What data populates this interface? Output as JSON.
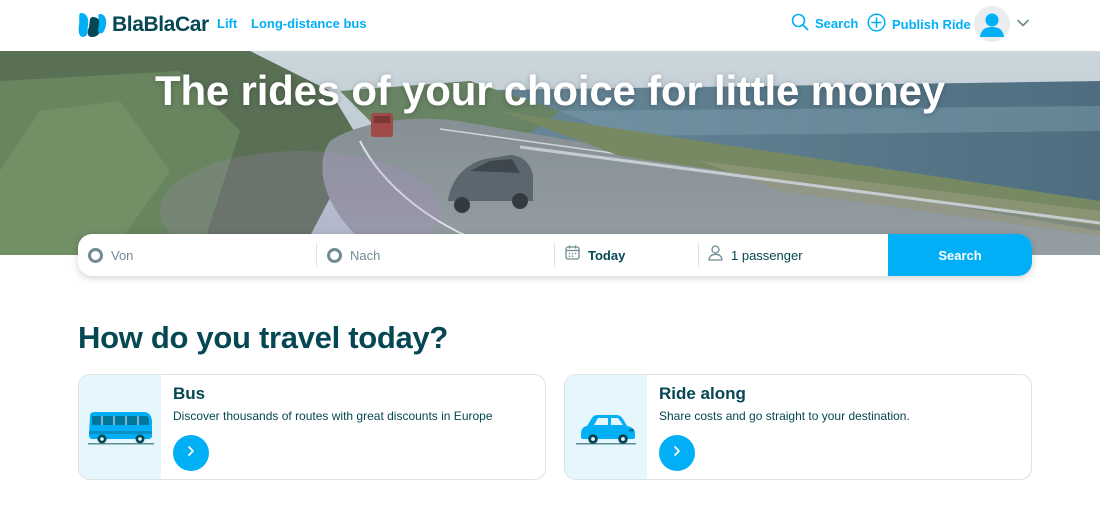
{
  "header": {
    "logo_text": "BlaBlaCar",
    "nav": {
      "lift": "Lift",
      "bus": "Long-distance bus"
    },
    "search_label": "Search",
    "publish_label": "Publish Ride",
    "icons": [
      "logo-icon",
      "search-icon",
      "plus-circle-icon",
      "user-avatar-icon",
      "chevron-down-icon"
    ]
  },
  "hero": {
    "title": "The rides of your choice for little money"
  },
  "searchbar": {
    "from_placeholder": "Von",
    "to_placeholder": "Nach",
    "date_value": "Today",
    "passengers_value": "1 passenger",
    "button_label": "Search",
    "icons": [
      "origin-ring-icon",
      "destination-ring-icon",
      "calendar-icon",
      "person-icon"
    ]
  },
  "travel": {
    "title": "How do you travel today?",
    "cards": [
      {
        "title": "Bus",
        "description": "Discover thousands of routes with great discounts in Europe",
        "icon": "bus-icon"
      },
      {
        "title": "Ride along",
        "description": "Share costs and go straight to your destination.",
        "icon": "car-icon"
      }
    ]
  },
  "colors": {
    "brand_blue": "#00aff5",
    "dark_teal": "#054752",
    "muted": "#708c91",
    "card_bg": "#e6f6fd"
  }
}
